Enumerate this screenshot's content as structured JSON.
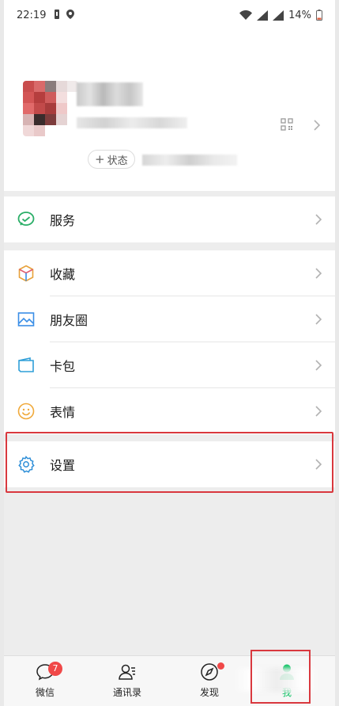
{
  "status_bar": {
    "time": "22:19",
    "battery": "14%"
  },
  "profile": {
    "status_button": "状态",
    "status_plus": "+"
  },
  "menu": {
    "service": {
      "label": "服务",
      "icon": "service-icon"
    },
    "favorites": {
      "label": "收藏",
      "icon": "cube-icon"
    },
    "moments": {
      "label": "朋友圈",
      "icon": "image-icon"
    },
    "cards": {
      "label": "卡包",
      "icon": "wallet-icon"
    },
    "stickers": {
      "label": "表情",
      "icon": "smile-icon"
    },
    "settings": {
      "label": "设置",
      "icon": "gear-icon"
    }
  },
  "tabbar": {
    "chats": {
      "label": "微信",
      "badge": "7"
    },
    "contacts": {
      "label": "通讯录"
    },
    "discover": {
      "label": "发现"
    },
    "me": {
      "label": "我"
    }
  },
  "colors": {
    "accent_green": "#07c160",
    "highlight_red": "#d9383e",
    "badge_red": "#f04848"
  }
}
